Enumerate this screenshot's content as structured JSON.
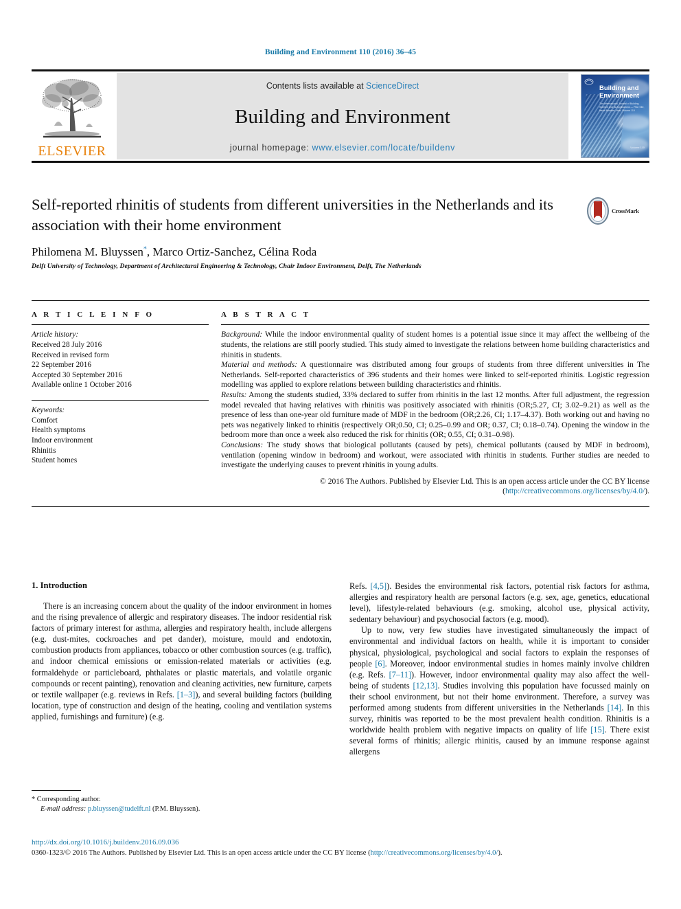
{
  "running_head": "Building and Environment 110 (2016) 36–45",
  "masthead": {
    "contents_prefix": "Contents lists available at ",
    "sciencedirect": "ScienceDirect",
    "journal_name": "Building and Environment",
    "homepage_label": "journal homepage: ",
    "homepage_url": "www.elsevier.com/locate/buildenv",
    "publisher_wordmark": "ELSEVIER",
    "cover_title": "Building and Environment",
    "cover_subtitle": "The International Journal of Building Science and its Applications — Plan Site, Issue Number, Year, Volume 110",
    "cover_issue": "Volume 110"
  },
  "article": {
    "title": "Self-reported rhinitis of students from different universities in the Netherlands and its association with their home environment",
    "authors_pre": "Philomena M. Bluyssen",
    "authors_star": "*",
    "authors_post": ", Marco Ortiz-Sanchez, Célina Roda",
    "affiliation": "Delft University of Technology, Department of Architectural Engineering & Technology, Chair Indoor Environment, Delft, The Netherlands",
    "crossmark_label": "CrossMark"
  },
  "info": {
    "heading": "A R T I C L E   I N F O",
    "history_label": "Article history:",
    "history_lines": [
      "Received 28 July 2016",
      "Received in revised form",
      "22 September 2016",
      "Accepted 30 September 2016",
      "Available online 1 October 2016"
    ],
    "keywords_label": "Keywords:",
    "keywords": [
      "Comfort",
      "Health symptoms",
      "Indoor environment",
      "Rhinitis",
      "Student homes"
    ]
  },
  "abstract": {
    "heading": "A B S T R A C T",
    "background_label": "Background:",
    "background_text": " While the indoor environmental quality of student homes is a potential issue since it may affect the wellbeing of the students, the relations are still poorly studied. This study aimed to investigate the relations between home building characteristics and rhinitis in students.",
    "methods_label": "Material and methods:",
    "methods_text": " A questionnaire was distributed among four groups of students from three different universities in The Netherlands. Self-reported characteristics of 396 students and their homes were linked to self-reported rhinitis. Logistic regression modelling was applied to explore relations between building characteristics and rhinitis.",
    "results_label": "Results:",
    "results_text": " Among the students studied, 33% declared to suffer from rhinitis in the last 12 months. After full adjustment, the regression model revealed that having relatives with rhinitis was positively associated with rhinitis (OR;5.27, CI; 3.02–9.21) as well as the presence of less than one-year old furniture made of MDF in the bedroom (OR;2.26, CI; 1.17–4.37). Both working out and having no pets was negatively linked to rhinitis (respectively OR;0.50, CI; 0.25–0.99 and OR; 0.37, CI; 0.18–0.74). Opening the window in the bedroom more than once a week also reduced the risk for rhinitis (OR; 0.55, CI; 0.31–0.98).",
    "conclusions_label": "Conclusions:",
    "conclusions_text": " The study shows that biological pollutants (caused by pets), chemical pollutants (caused by MDF in bedroom), ventilation (opening window in bedroom) and workout, were associated with rhinitis in students. Further studies are needed to investigate the underlying causes to prevent rhinitis in young adults.",
    "copyright_line": "© 2016 The Authors. Published by Elsevier Ltd. This is an open access article under the CC BY license",
    "license_open": "(",
    "license_url": "http://creativecommons.org/licenses/by/4.0/",
    "license_close": ")."
  },
  "body": {
    "section_number_title": "1. Introduction",
    "left_paragraph_1": "There is an increasing concern about the quality of the indoor environment in homes and the rising prevalence of allergic and respiratory diseases. The indoor residential risk factors of primary interest for asthma, allergies and respiratory health, include allergens (e.g. dust-mites, cockroaches and pet dander), moisture, mould and endotoxin, combustion products from appliances, tobacco or other combustion sources (e.g. traffic), and indoor chemical emissions or emission-related materials or activities (e.g. formaldehyde or particleboard, phthalates or plastic materials, and volatile organic compounds or recent painting), renovation and cleaning activities, new furniture, carpets or textile wallpaper (e.g. reviews in Refs. ",
    "ref_1_3": "[1–3]",
    "left_paragraph_1_cont": "), and several building factors (building location, type of construction and design of the heating, cooling and ventilation systems applied, furnishings and furniture) (e.g.",
    "right_paragraph_1_open": "Refs. ",
    "ref_4_5": "[4,5]",
    "right_paragraph_1": "). Besides the environmental risk factors, potential risk factors for asthma, allergies and respiratory health are personal factors (e.g. sex, age, genetics, educational level), lifestyle-related behaviours (e.g. smoking, alcohol use, physical activity, sedentary behaviour) and psychosocial factors (e.g. mood).",
    "right_paragraph_2_a": "Up to now, very few studies have investigated simultaneously the impact of environmental and individual factors on health, while it is important to consider physical, physiological, psychological and social factors to explain the responses of people ",
    "ref_6": "[6]",
    "right_paragraph_2_b": ". Moreover, indoor environmental studies in homes mainly involve children (e.g. Refs. ",
    "ref_7_11": "[7–11]",
    "right_paragraph_2_c": "). However, indoor environmental quality may also affect the well-being of students ",
    "ref_12_13": "[12,13]",
    "right_paragraph_2_d": ". Studies involving this population have focussed mainly on their school environment, but not their home environment. Therefore, a survey was performed among students from different universities in the Netherlands ",
    "ref_14": "[14]",
    "right_paragraph_2_e": ". In this survey, rhinitis was reported to be the most prevalent health condition. Rhinitis is a worldwide health problem with negative impacts on quality of life ",
    "ref_15": "[15]",
    "right_paragraph_2_f": ". There exist several forms of rhinitis; allergic rhinitis, caused by an immune response against allergens"
  },
  "footnote": {
    "corresponding": "* Corresponding author.",
    "email_label": "E-mail address: ",
    "email": "p.bluyssen@tudelft.nl",
    "email_suffix": " (P.M. Bluyssen)."
  },
  "bottom": {
    "doi": "http://dx.doi.org/10.1016/j.buildenv.2016.09.036",
    "license_pre": "0360-1323/© 2016 The Authors. Published by Elsevier Ltd. This is an open access article under the CC BY license (",
    "license_url": "http://creativecommons.org/licenses/by/4.0/",
    "license_post": ")."
  },
  "colors": {
    "link_blue": "#1a7aa8",
    "elsevier_orange": "#E8820C",
    "panel_grey": "#e3e3e3"
  }
}
